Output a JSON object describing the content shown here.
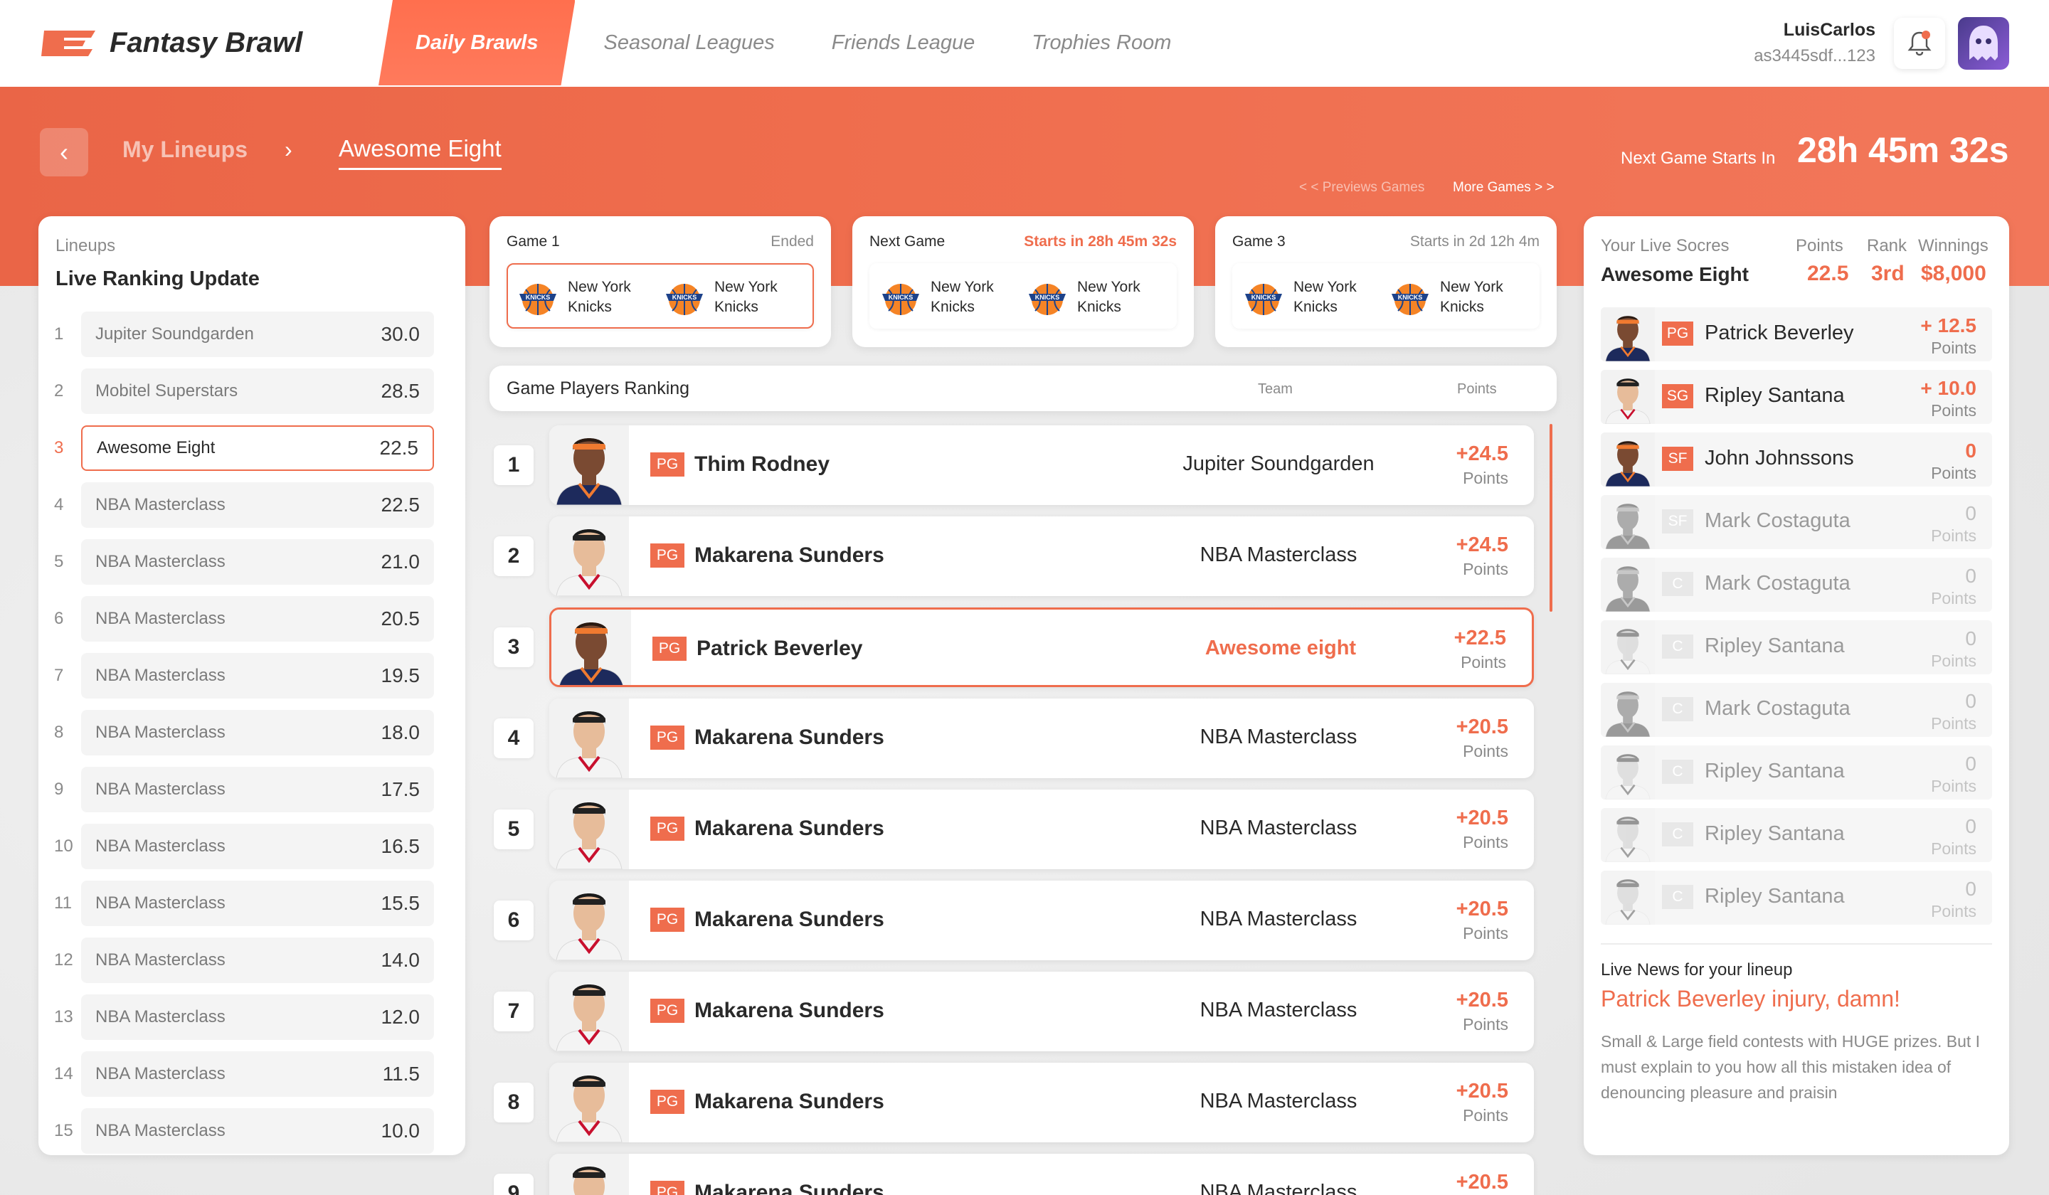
{
  "app": {
    "name": "Fantasy Brawl"
  },
  "nav": {
    "tabs": [
      {
        "label": "Daily Brawls",
        "active": true
      },
      {
        "label": "Seasonal Leagues"
      },
      {
        "label": "Friends League"
      },
      {
        "label": "Trophies Room"
      }
    ]
  },
  "user": {
    "name": "LuisCarlos",
    "id": "as3445sdf...123",
    "notification_dot": "#ef6d4d"
  },
  "breadcrumb": {
    "parent": "My Lineups",
    "current": "Awesome Eight",
    "separator": "›",
    "back": "‹"
  },
  "next_game": {
    "label": "Next Game Starts In",
    "countdown": "28h 45m 32s",
    "prev_link": "< < Previews Games",
    "more_link": "More Games > >"
  },
  "lineups": {
    "label": "Lineups",
    "title": "Live Ranking Update",
    "rows": [
      {
        "rank": "1",
        "name": "Jupiter Soundgarden",
        "score": "30.0"
      },
      {
        "rank": "2",
        "name": "Mobitel Superstars",
        "score": "28.5"
      },
      {
        "rank": "3",
        "name": "Awesome Eight",
        "score": "22.5",
        "selected": true
      },
      {
        "rank": "4",
        "name": "NBA Masterclass",
        "score": "22.5"
      },
      {
        "rank": "5",
        "name": "NBA Masterclass",
        "score": "21.0"
      },
      {
        "rank": "6",
        "name": "NBA Masterclass",
        "score": "20.5"
      },
      {
        "rank": "7",
        "name": "NBA Masterclass",
        "score": "19.5"
      },
      {
        "rank": "8",
        "name": "NBA Masterclass",
        "score": "18.0"
      },
      {
        "rank": "9",
        "name": "NBA Masterclass",
        "score": "17.5"
      },
      {
        "rank": "10",
        "name": "NBA Masterclass",
        "score": "16.5"
      },
      {
        "rank": "11",
        "name": "NBA Masterclass",
        "score": "15.5"
      },
      {
        "rank": "12",
        "name": "NBA Masterclass",
        "score": "14.0"
      },
      {
        "rank": "13",
        "name": "NBA Masterclass",
        "score": "12.0"
      },
      {
        "rank": "14",
        "name": "NBA Masterclass",
        "score": "11.5"
      },
      {
        "rank": "15",
        "name": "NBA Masterclass",
        "score": "10.0"
      }
    ]
  },
  "games": [
    {
      "title": "Game 1",
      "status": "Ended",
      "teams": [
        "New York Knicks",
        "New York Knicks"
      ],
      "selected": true
    },
    {
      "title": "Next Game",
      "status": "Starts in 28h 45m 32s",
      "hot": true,
      "teams": [
        "New York Knicks",
        "New York Knicks"
      ]
    },
    {
      "title": "Game 3",
      "status": "Starts in 2d 12h 4m",
      "teams": [
        "New York Knicks",
        "New York Knicks"
      ]
    }
  ],
  "ranking": {
    "title": "Game Players Ranking",
    "col_team": "Team",
    "col_points": "Points",
    "rows": [
      {
        "rank": "1",
        "pos": "PG",
        "name": "Thim Rodney",
        "team": "Jupiter Soundgarden",
        "points": "+24.5",
        "unit": "Points",
        "face": "dark"
      },
      {
        "rank": "2",
        "pos": "PG",
        "name": "Makarena Sunders",
        "team": "NBA Masterclass",
        "points": "+24.5",
        "unit": "Points",
        "face": "light"
      },
      {
        "rank": "3",
        "pos": "PG",
        "name": "Patrick Beverley",
        "team": "Awesome eight",
        "points": "+22.5",
        "unit": "Points",
        "face": "dark",
        "selected": true
      },
      {
        "rank": "4",
        "pos": "PG",
        "name": "Makarena Sunders",
        "team": "NBA Masterclass",
        "points": "+20.5",
        "unit": "Points",
        "face": "light"
      },
      {
        "rank": "5",
        "pos": "PG",
        "name": "Makarena Sunders",
        "team": "NBA Masterclass",
        "points": "+20.5",
        "unit": "Points",
        "face": "light"
      },
      {
        "rank": "6",
        "pos": "PG",
        "name": "Makarena Sunders",
        "team": "NBA Masterclass",
        "points": "+20.5",
        "unit": "Points",
        "face": "light"
      },
      {
        "rank": "7",
        "pos": "PG",
        "name": "Makarena Sunders",
        "team": "NBA Masterclass",
        "points": "+20.5",
        "unit": "Points",
        "face": "light"
      },
      {
        "rank": "8",
        "pos": "PG",
        "name": "Makarena Sunders",
        "team": "NBA Masterclass",
        "points": "+20.5",
        "unit": "Points",
        "face": "light"
      },
      {
        "rank": "9",
        "pos": "PG",
        "name": "Makarena Sunders",
        "team": "NBA Masterclass",
        "points": "+20.5",
        "unit": "Points",
        "face": "light"
      }
    ]
  },
  "live_scores": {
    "label": "Your Live Socres",
    "lineup": "Awesome Eight",
    "col_points": "Points",
    "col_rank": "Rank",
    "col_winnings": "Winnings",
    "points": "22.5",
    "rank": "3rd",
    "winnings": "$8,000",
    "players": [
      {
        "pos": "PG",
        "name": "Patrick Beverley",
        "points": "+ 12.5",
        "unit": "Points",
        "face": "dark"
      },
      {
        "pos": "SG",
        "name": "Ripley Santana",
        "points": "+ 10.0",
        "unit": "Points",
        "face": "light"
      },
      {
        "pos": "SF",
        "name": "John Johnssons",
        "points": "0",
        "unit": "Points",
        "face": "dark"
      },
      {
        "pos": "SF",
        "name": "Mark Costaguta",
        "points": "0",
        "unit": "Points",
        "face": "dark",
        "dim": true
      },
      {
        "pos": "C",
        "name": "Mark Costaguta",
        "points": "0",
        "unit": "Points",
        "face": "dark",
        "dim": true
      },
      {
        "pos": "C",
        "name": "Ripley Santana",
        "points": "0",
        "unit": "Points",
        "face": "light",
        "dim": true
      },
      {
        "pos": "C",
        "name": "Mark Costaguta",
        "points": "0",
        "unit": "Points",
        "face": "dark",
        "dim": true
      },
      {
        "pos": "C",
        "name": "Ripley Santana",
        "points": "0",
        "unit": "Points",
        "face": "light",
        "dim": true
      },
      {
        "pos": "C",
        "name": "Ripley Santana",
        "points": "0",
        "unit": "Points",
        "face": "light",
        "dim": true
      },
      {
        "pos": "C",
        "name": "Ripley Santana",
        "points": "0",
        "unit": "Points",
        "face": "light",
        "dim": true
      }
    ]
  },
  "news": {
    "label": "Live News for your lineup",
    "headline": "Patrick Beverley injury, damn!",
    "body": "Small & Large field contests with HUGE prizes. But I must explain to you how all this mistaken idea of denouncing pleasure and praisin"
  },
  "colors": {
    "accent": "#ef6d4d",
    "banner": "#ee6b4c"
  },
  "icons": [
    "logo-icon",
    "bell-icon",
    "ghost-avatar-icon",
    "back-chevron-icon",
    "knicks-logo-icon",
    "player-photo-icon"
  ]
}
